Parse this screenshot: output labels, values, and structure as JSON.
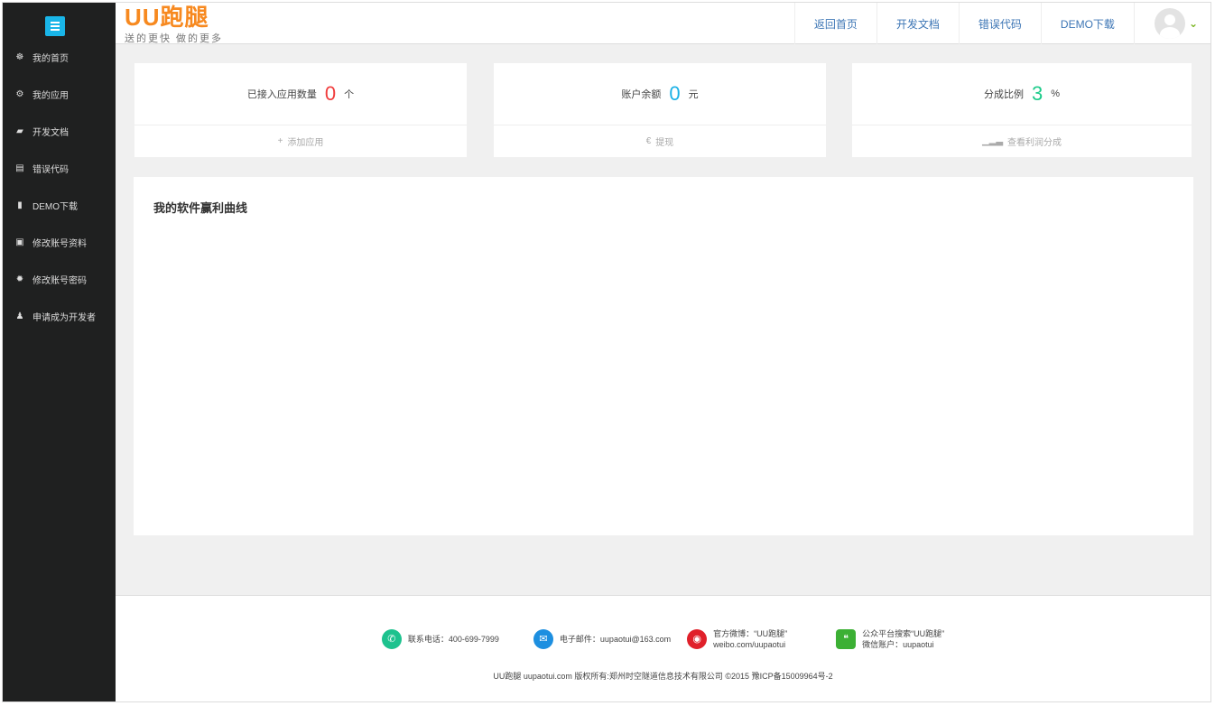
{
  "brand": {
    "logo": "UU跑腿",
    "slogan": "送的更快 做的更多"
  },
  "sidebar": {
    "items": [
      {
        "label": "我的首页",
        "icon": "dashboard-icon",
        "glyph": "☸"
      },
      {
        "label": "我的应用",
        "icon": "cogs-icon",
        "glyph": "⚙"
      },
      {
        "label": "开发文档",
        "icon": "book-icon",
        "glyph": "▰"
      },
      {
        "label": "错误代码",
        "icon": "file-code-icon",
        "glyph": "▤"
      },
      {
        "label": "DEMO下载",
        "icon": "file-icon",
        "glyph": "▮"
      },
      {
        "label": "修改账号资料",
        "icon": "save-icon",
        "glyph": "▣"
      },
      {
        "label": "修改账号密码",
        "icon": "gear-icon",
        "glyph": "✹"
      },
      {
        "label": "申请成为开发者",
        "icon": "user-icon",
        "glyph": "♟"
      }
    ]
  },
  "topnav": [
    "返回首页",
    "开发文档",
    "错误代码",
    "DEMO下载"
  ],
  "stats": [
    {
      "label": "已接入应用数量",
      "value": "0",
      "unit": "个",
      "color": "#f03c3c",
      "action": "添加应用",
      "action_glyph": "+"
    },
    {
      "label": "账户余额",
      "value": "0",
      "unit": "元",
      "color": "#1ab1e6",
      "action": "提现",
      "action_glyph": "€"
    },
    {
      "label": "分成比例",
      "value": "3",
      "unit": "%",
      "color": "#1dcb8a",
      "action": "查看利润分成",
      "action_glyph": "▁▂▃"
    }
  ],
  "panel": {
    "title": "我的软件赢利曲线"
  },
  "footer": {
    "phone": "联系电话：400-699-7999",
    "email": "电子邮件：uupaotui@163.com",
    "weibo_1": "官方微博：“UU跑腿”",
    "weibo_2": "weibo.com/uupaotui",
    "wechat_1": "公众平台搜索“UU跑腿”",
    "wechat_2": "微信账户：uupaotui",
    "copyright": "UU跑腿 uupaotui.com 版权所有:郑州时空隧道信息技术有限公司 ©2015 豫ICP备15009964号-2"
  }
}
